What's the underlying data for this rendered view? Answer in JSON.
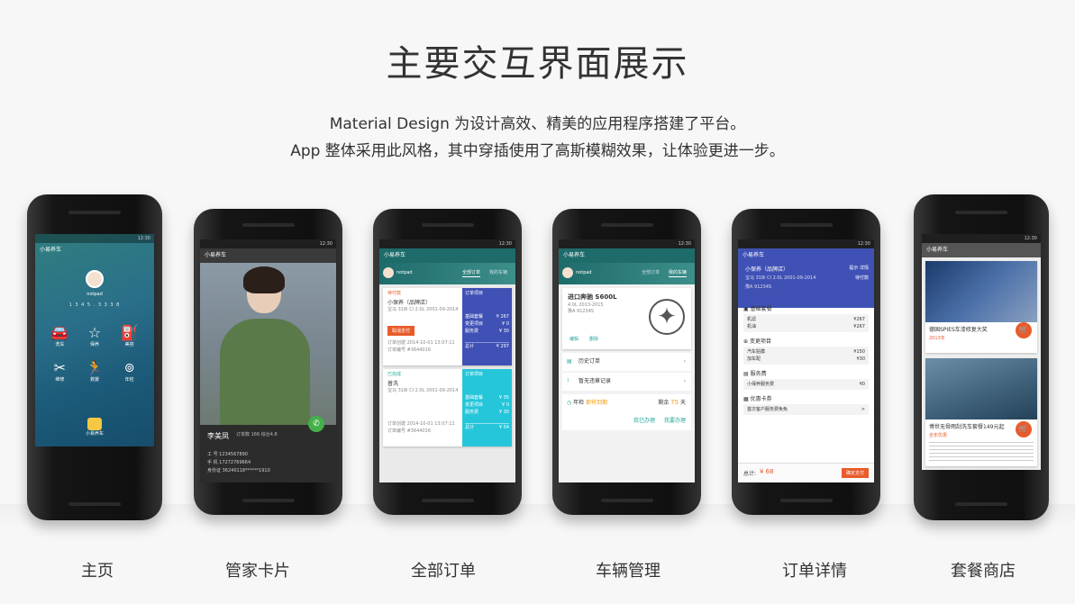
{
  "header": {
    "title": "主要交互界面展示",
    "line1": "Material Design 为设计高效、精美的应用程序搭建了平台。",
    "line2": "App 整体采用此风格，其中穿插使用了高斯模糊效果，让体验更进一步。"
  },
  "captions": [
    "主页",
    "管家卡片",
    "全部订单",
    "车辆管理",
    "订单详情",
    "套餐商店"
  ],
  "status_time": "12:30",
  "app_name": "小易养车",
  "home": {
    "user": "notpad",
    "phone": "1 3 4 5 . 3 3 3 8",
    "tiles": [
      "洗车",
      "保养",
      "美容",
      "维修",
      "救援",
      "年检"
    ],
    "logo_label": "小易养车"
  },
  "butler": {
    "name": "李美凤",
    "meta": "订单数 166 综合4.8",
    "rows": [
      "工  号 1234567890",
      "手  机 17272769664",
      "身份证 36240118******1910"
    ]
  },
  "orders": {
    "user": "notpad",
    "tabs": [
      "全部订单",
      "我的车辆"
    ],
    "cards": [
      {
        "status": "待付款",
        "title": "小保养（品牌店）",
        "desc": "宝马 318i CI 2.0L 2001-09-2014",
        "time": "订单创建 2014-10-01 13:07:11",
        "no": "订单编号 #3644016",
        "btn": "取消支付",
        "side_title": "订单项目",
        "items": [
          [
            "基础套餐",
            "¥ 267"
          ],
          [
            "变更项目",
            "¥ 0"
          ],
          [
            "服务费",
            "¥ 30"
          ]
        ],
        "total": [
          "总计",
          "¥ 297"
        ]
      },
      {
        "status": "已完成",
        "title": "普洗",
        "desc": "宝马 318i CI 2.0L 2001-09-2014",
        "time": "订单创建 2014-10-01 13:07:11",
        "no": "订单编号 #3644016",
        "side_title": "订单项目",
        "items": [
          [
            "基础套餐",
            "¥ 35"
          ],
          [
            "变更项目",
            "¥ 0"
          ],
          [
            "服务费",
            "¥ 30"
          ]
        ],
        "total": [
          "总计",
          "¥ 54"
        ]
      }
    ]
  },
  "vehicle": {
    "user": "notpad",
    "tabs": [
      "全部订单",
      "我的车辆"
    ],
    "model": "进口奔驰 S600L",
    "spec": "4.0L 2013-2015",
    "plate": "豫A 91234S",
    "edit": "编辑",
    "delete": "删除",
    "rows": [
      "历史订单",
      "暂无违章记录"
    ],
    "annual": [
      "年检",
      "即将到期",
      "剩余",
      "75",
      "天"
    ],
    "actions": [
      "我已办理",
      "我要办理"
    ]
  },
  "detail": {
    "title": "小保养（品牌店）",
    "link": "提示 详情",
    "car": "宝马 318i CI 2.0L 2001-09-2014",
    "status": "待付款",
    "plate": "豫A 91234S",
    "sections": [
      {
        "name": "基础套餐",
        "lines": [
          [
            "机滤",
            "¥267"
          ],
          [
            "机油",
            "¥267"
          ]
        ]
      },
      {
        "name": "变更项目",
        "lines": [
          [
            "汽车贴膜",
            "¥150"
          ],
          [
            "加车配",
            "¥30"
          ]
        ]
      },
      {
        "name": "服务费",
        "lines": [
          [
            "小保养服务费",
            "¥0"
          ]
        ]
      },
      {
        "name": "优惠卡券",
        "lines": [
          [
            "首次客户服务费免免",
            ">"
          ]
        ]
      }
    ],
    "total_label": "总计:",
    "total": "¥ 68",
    "pay": "确定支付"
  },
  "store": {
    "items": [
      {
        "title": "德国SPIES车漆修复大奖",
        "tag": "2013年"
      },
      {
        "title": "博世无骨雨刮洗车套餐149元起",
        "tag": "全年优惠"
      }
    ]
  },
  "colors": {
    "accent": "#e95b2a",
    "indigo": "#3f51b5",
    "cyan": "#26c6da",
    "teal": "#1e6b6b",
    "green": "#43b04a"
  }
}
